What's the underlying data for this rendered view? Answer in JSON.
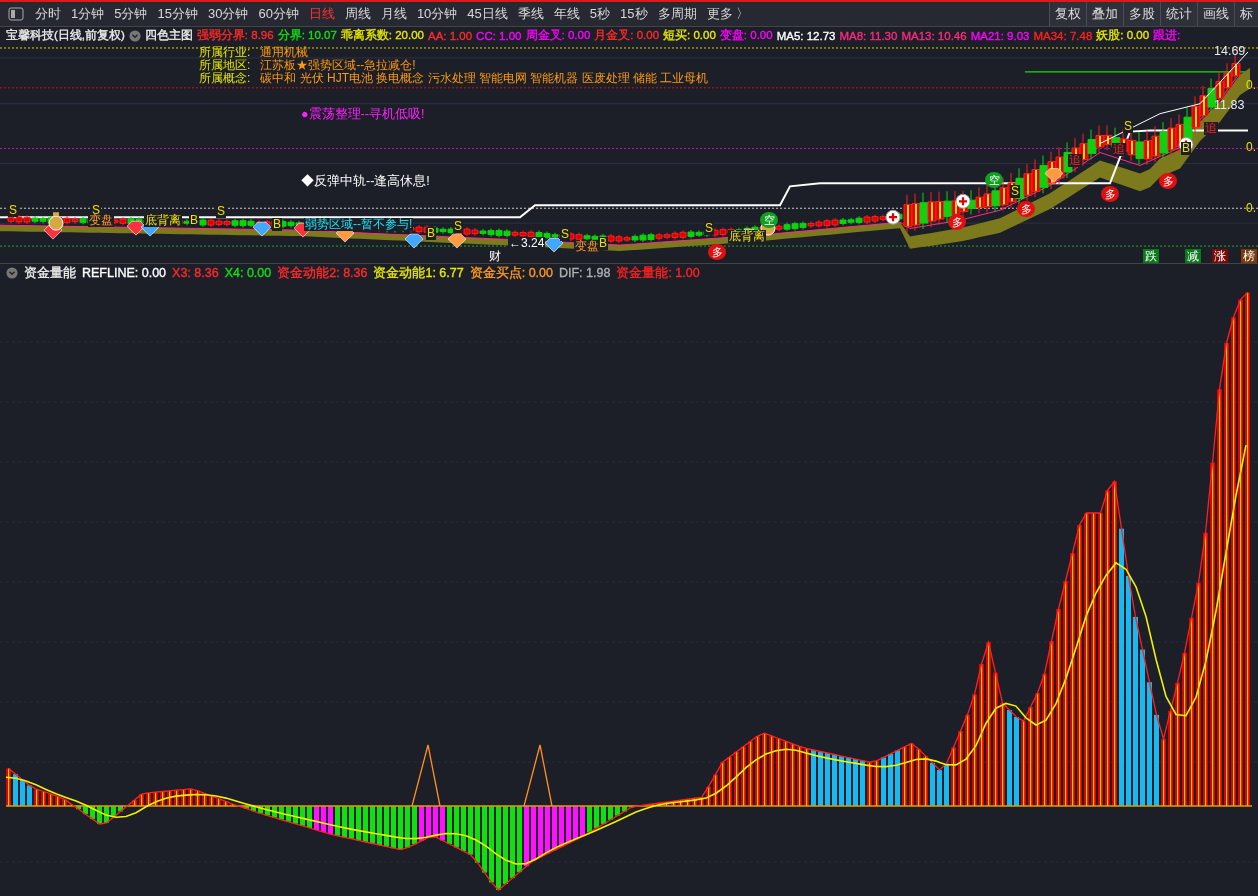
{
  "toolbar": {
    "tabs": [
      {
        "label": "分时",
        "selected": false
      },
      {
        "label": "1分钟",
        "selected": false
      },
      {
        "label": "5分钟",
        "selected": false
      },
      {
        "label": "15分钟",
        "selected": false
      },
      {
        "label": "30分钟",
        "selected": false
      },
      {
        "label": "60分钟",
        "selected": false
      },
      {
        "label": "日线",
        "selected": true
      },
      {
        "label": "周线",
        "selected": false
      },
      {
        "label": "月线",
        "selected": false
      },
      {
        "label": "10分钟",
        "selected": false
      },
      {
        "label": "45日线",
        "selected": false
      },
      {
        "label": "季线",
        "selected": false
      },
      {
        "label": "年线",
        "selected": false
      },
      {
        "label": "5秒",
        "selected": false
      },
      {
        "label": "15秒",
        "selected": false
      },
      {
        "label": "多周期",
        "selected": false
      },
      {
        "label": "更多 〉",
        "selected": false
      }
    ],
    "buttons": [
      "复权",
      "叠加",
      "多股",
      "统计",
      "画线",
      "标"
    ]
  },
  "main_chart": {
    "title": "宝馨科技(日线,前复权)",
    "indicator": "四色主图",
    "legend": [
      {
        "label": "强弱分界: 8.96",
        "color": "#ff2a2a"
      },
      {
        "label": "分界: 10.07",
        "color": "#10e010"
      },
      {
        "label": "乖离系数: 20.00",
        "color": "#e6e600"
      },
      {
        "label": "AA: 1.00",
        "color": "#ff2a2a"
      },
      {
        "label": "CC: 1.00",
        "color": "#ff00ff"
      },
      {
        "label": "周金叉: 0.00",
        "color": "#ff00ff"
      },
      {
        "label": "月金叉: 0.00",
        "color": "#ff2a2a"
      },
      {
        "label": "短买: 0.00",
        "color": "#e6e600"
      },
      {
        "label": "变盘: 0.00",
        "color": "#ff00ff"
      },
      {
        "label": "MA5: 12.73",
        "color": "#ffffff"
      },
      {
        "label": "MA8: 11.30",
        "color": "#ff2a7a"
      },
      {
        "label": "MA13: 10.46",
        "color": "#ff2a7a"
      },
      {
        "label": "MA21: 9.03",
        "color": "#ff00ff"
      },
      {
        "label": "MA34: 7.48",
        "color": "#ff2020"
      },
      {
        "label": "妖股: 0.00",
        "color": "#e6e600"
      },
      {
        "label": "跟进:",
        "color": "#ff00ff"
      }
    ],
    "info": [
      {
        "label": "所属行业:",
        "value": "通用机械"
      },
      {
        "label": "所属地区:",
        "value": "江苏板★强势区域--急拉减仓!"
      },
      {
        "label": "所属概念:",
        "value": "碳中和 光伏 HJT电池 换电概念 污水处理 智能电网 智能机器 医废处理 储能 工业母机"
      }
    ],
    "signals": [
      {
        "text": "●震荡整理--寻机低吸!",
        "kind": "alert"
      },
      {
        "text": "◆反弹中轨--逢高休息!",
        "kind": "notice"
      }
    ],
    "markers": [
      {
        "text": "S",
        "kind": "sell"
      },
      {
        "text": "S",
        "kind": "sell"
      },
      {
        "text": "变盘",
        "kind": "pattern"
      },
      {
        "text": "底背离",
        "kind": "divergence"
      },
      {
        "text": "B",
        "kind": "buy"
      },
      {
        "text": "S",
        "kind": "sell"
      },
      {
        "text": "B",
        "kind": "buy"
      },
      {
        "text": "弱势区域--暂不参与!",
        "kind": "zone"
      },
      {
        "text": "B",
        "kind": "buy"
      },
      {
        "text": "S",
        "kind": "sell"
      },
      {
        "text": "财",
        "kind": "label"
      },
      {
        "text": "←3.24",
        "kind": "label"
      },
      {
        "text": "S",
        "kind": "sell"
      },
      {
        "text": "变盘",
        "kind": "pattern"
      },
      {
        "text": "B",
        "kind": "buy"
      },
      {
        "text": "S",
        "kind": "sell"
      },
      {
        "text": "底背离",
        "kind": "divergence"
      },
      {
        "text": "S",
        "kind": "sell"
      },
      {
        "text": "S",
        "kind": "sell"
      },
      {
        "text": "B",
        "kind": "buy"
      },
      {
        "text": "追",
        "kind": "chase"
      },
      {
        "text": "追",
        "kind": "chase"
      },
      {
        "text": "追",
        "kind": "chase"
      },
      {
        "text": "多",
        "kind": "long"
      },
      {
        "text": "多",
        "kind": "long"
      },
      {
        "text": "多",
        "kind": "long"
      },
      {
        "text": "多",
        "kind": "long"
      },
      {
        "text": "多",
        "kind": "long"
      },
      {
        "text": "空",
        "kind": "short"
      },
      {
        "text": "空",
        "kind": "short"
      }
    ],
    "price_labels": [
      "14.69",
      "11.83"
    ],
    "axis_labels": [
      "0.",
      "0.",
      "0."
    ],
    "badges": [
      {
        "text": "跌",
        "color": "#0a7a1a"
      },
      {
        "text": "减",
        "color": "#0a7a1a"
      },
      {
        "text": "涨",
        "color": "#7a0a0a"
      },
      {
        "text": "榜",
        "color": "#7a3a0a"
      }
    ]
  },
  "sub_chart": {
    "title": "资金量能",
    "legend": [
      {
        "label": "REFLINE: 0.00",
        "color": "#ffffff"
      },
      {
        "label": "X3: 8.36",
        "color": "#ff2a2a"
      },
      {
        "label": "X4: 0.00",
        "color": "#10e010"
      },
      {
        "label": "资金动能2: 8.36",
        "color": "#ff2a2a"
      },
      {
        "label": "资金动能1: 6.77",
        "color": "#e6e600"
      },
      {
        "label": "资金买点: 0.00",
        "color": "#ff9a20"
      },
      {
        "label": "DIF: 1.98",
        "color": "#b0b0b0"
      },
      {
        "label": "资金量能: 1.00",
        "color": "#ff2020"
      }
    ]
  }
}
